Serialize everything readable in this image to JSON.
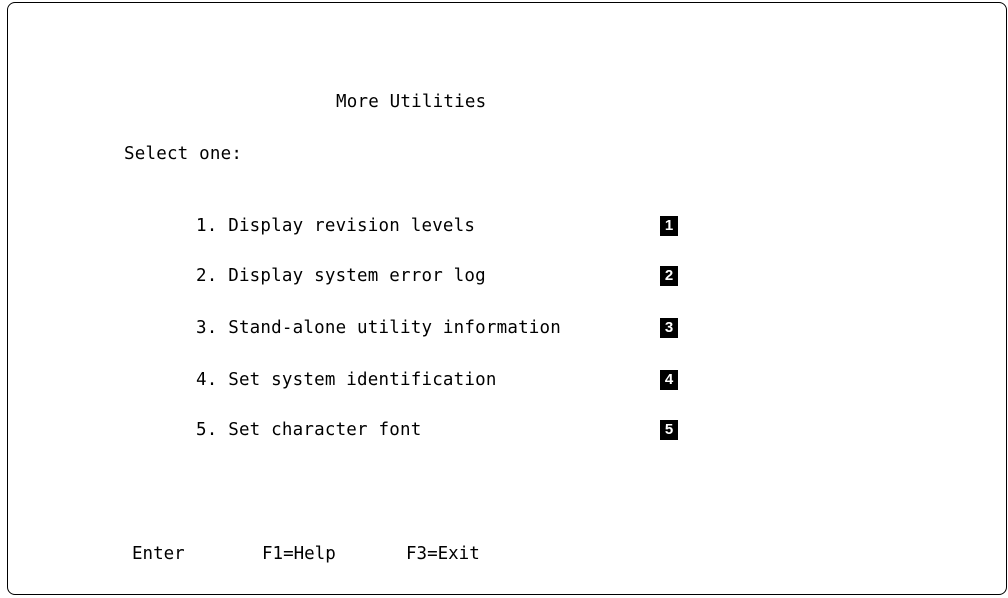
{
  "screen": {
    "title": "More Utilities",
    "prompt": "Select one:"
  },
  "menu": {
    "items": [
      {
        "label": "1. Display revision levels",
        "badge": "1"
      },
      {
        "label": "2. Display system error log",
        "badge": "2"
      },
      {
        "label": "3. Stand-alone utility information",
        "badge": "3"
      },
      {
        "label": "4. Set system identification",
        "badge": "4"
      },
      {
        "label": "5. Set character font",
        "badge": "5"
      }
    ]
  },
  "function_keys": {
    "enter": "Enter",
    "help": "F1=Help",
    "exit": "F3=Exit"
  }
}
